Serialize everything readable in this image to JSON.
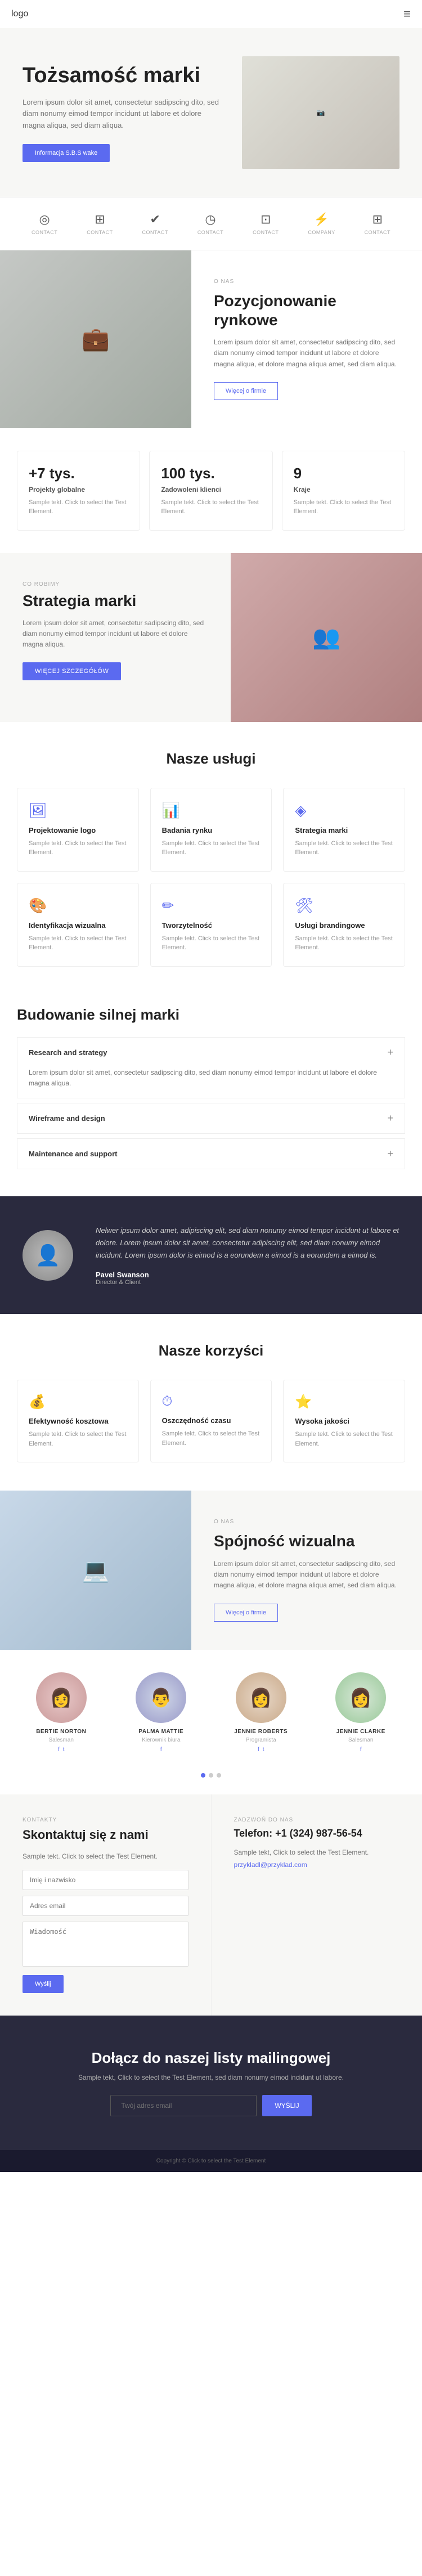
{
  "nav": {
    "logo": "logo",
    "menu_icon": "≡"
  },
  "hero": {
    "title": "Tożsamość marki",
    "description": "Lorem ipsum dolor sit amet, consectetur sadipscing dito, sed diam nonumy eimod tempor incidunt ut labore et dolore magna aliqua, sed diam aliqua.",
    "button": "Informacja S.B.S wake"
  },
  "icons_row": [
    {
      "symbol": "◎",
      "label": "CONTACT"
    },
    {
      "symbol": "⊞",
      "label": "CONTACT"
    },
    {
      "symbol": "✔",
      "label": "CONTACT"
    },
    {
      "symbol": "◷",
      "label": "CONTACT"
    },
    {
      "symbol": "⊡",
      "label": "CONTACT"
    },
    {
      "symbol": "⚡",
      "label": "COMPANY"
    },
    {
      "symbol": "⊞",
      "label": "CONTACT"
    }
  ],
  "positioning": {
    "label": "O NAS",
    "title": "Pozycjonowanie rynkowe",
    "description": "Lorem ipsum dolor sit amet, consectetur sadipscing dito, sed diam nonumy eimod tempor incidunt ut labore et dolore magna aliqua, et dolore magna aliqua amet, sed diam aliqua.",
    "button": "Więcej o firmie"
  },
  "stats": [
    {
      "number": "+7 tys.",
      "label": "Projekty globalne",
      "desc": "Sample tekt. Click to select the Test Element."
    },
    {
      "number": "100 tys.",
      "label": "Zadowoleni klienci",
      "desc": "Sample tekt. Click to select the Test Element."
    },
    {
      "number": "9",
      "label": "Kraje",
      "desc": "Sample tekt. Click to select the Test Element."
    }
  ],
  "strategy": {
    "label": "CO ROBIMY",
    "title": "Strategia marki",
    "description": "Lorem ipsum dolor sit amet, consectetur sadipscing dito, sed diam nonumy eimod tempor incidunt ut labore et dolore magna aliqua.",
    "button": "WIĘCEJ SZCZEGÓŁÓW"
  },
  "services": {
    "title": "Nasze usługi",
    "items": [
      {
        "icon": "🖼",
        "title": "Projektowanie logo",
        "desc": "Sample tekt. Click to select the Test Element."
      },
      {
        "icon": "📊",
        "title": "Badania rynku",
        "desc": "Sample tekt. Click to select the Test Element."
      },
      {
        "icon": "◈",
        "title": "Strategia marki",
        "desc": "Sample tekt. Click to select the Test Element."
      },
      {
        "icon": "🎨",
        "title": "Identyfikacja wizualna",
        "desc": "Sample tekt. Click to select the Test Element."
      },
      {
        "icon": "✏",
        "title": "Tworzytelność",
        "desc": "Sample tekt. Click to select the Test Element."
      },
      {
        "icon": "🛠",
        "title": "Usługi brandingowe",
        "desc": "Sample tekt. Click to select the Test Element."
      }
    ]
  },
  "build_brand": {
    "title": "Budowanie silnej marki",
    "items": [
      {
        "title": "Research and strategy",
        "open": true,
        "body": "Lorem ipsum dolor sit amet, consectetur sadipscing dito, sed diam nonumy eimod tempor incidunt ut labore et dolore magna aliqua."
      },
      {
        "title": "Wireframe and design",
        "open": false,
        "body": ""
      },
      {
        "title": "Maintenance and support",
        "open": false,
        "body": ""
      }
    ]
  },
  "testimonial": {
    "text": "Nełwer ipsum dolor amet, adipiscing elit, sed diam nonumy eimod tempor incidunt ut labore et dolore. Lorem ipsum dolor sit amet, consectetur adipiscing elit, sed diam nonumy eimod incidunt. Lorem ipsum dolor is eimod is a eorundem a eimod is a eorundem a eimod is.",
    "name": "Pavel Swanson",
    "role": "Director & Client"
  },
  "benefits": {
    "title": "Nasze korzyści",
    "items": [
      {
        "icon": "💰",
        "title": "Efektywność kosztowa",
        "desc": "Sample tekt. Click to select the Test Element."
      },
      {
        "icon": "⏱",
        "title": "Oszczędność czasu",
        "desc": "Sample tekt. Click to select the Test Element."
      },
      {
        "icon": "⭐",
        "title": "Wysoka jakości",
        "desc": "Sample tekt. Click to select the Test Element."
      }
    ]
  },
  "visual_identity": {
    "label": "O NAS",
    "title": "Spójność wizualna",
    "description": "Lorem ipsum dolor sit amet, consectetur sadipscing dito, sed diam nonumy eimod tempor incidunt ut labore et dolore magna aliqua, et dolore magna aliqua amet, sed diam aliqua.",
    "button": "Więcej o firmie"
  },
  "team": {
    "members": [
      {
        "name": "BERTIE NORTON",
        "role": "Salesman",
        "links": [
          "fb",
          "tw"
        ]
      },
      {
        "name": "PALMA MATTIE",
        "role": "Kierownik biura",
        "links": [
          "fb"
        ]
      },
      {
        "name": "JENNIE ROBERTS",
        "role": "Programista",
        "links": [
          "fb",
          "tw"
        ]
      },
      {
        "name": "JENNIE CLARKE",
        "role": "Salesman",
        "links": [
          "fb"
        ]
      }
    ]
  },
  "pagination": {
    "dots": 3,
    "active": 0
  },
  "contact": {
    "form_label": "KONTAKTY",
    "form_title": "Skontaktuj się z nami",
    "form_desc": "Sample tekt. Click to select the Test Element.",
    "phone_label": "ZADZWOŃ DO NAS",
    "phone": "Telefon: +1 (324) 987-56-54",
    "address": "Sample tekt, Click to select the Test Element.",
    "email_label": "przykladl@przyklad.com",
    "input_name": "Imię i nazwisko",
    "input_email": "Adres email",
    "input_message": "Wiadomość"
  },
  "newsletter": {
    "title": "Dołącz do naszej listy mailingowej",
    "desc": "Sample tekt, Click to select the Test Element, sed diam nonumy eimod incidunt ut labore.",
    "placeholder": "Twój adres email",
    "button": "WYŚLIJ"
  },
  "footer": {
    "text": "Copyright © Click to select the Test Element"
  }
}
